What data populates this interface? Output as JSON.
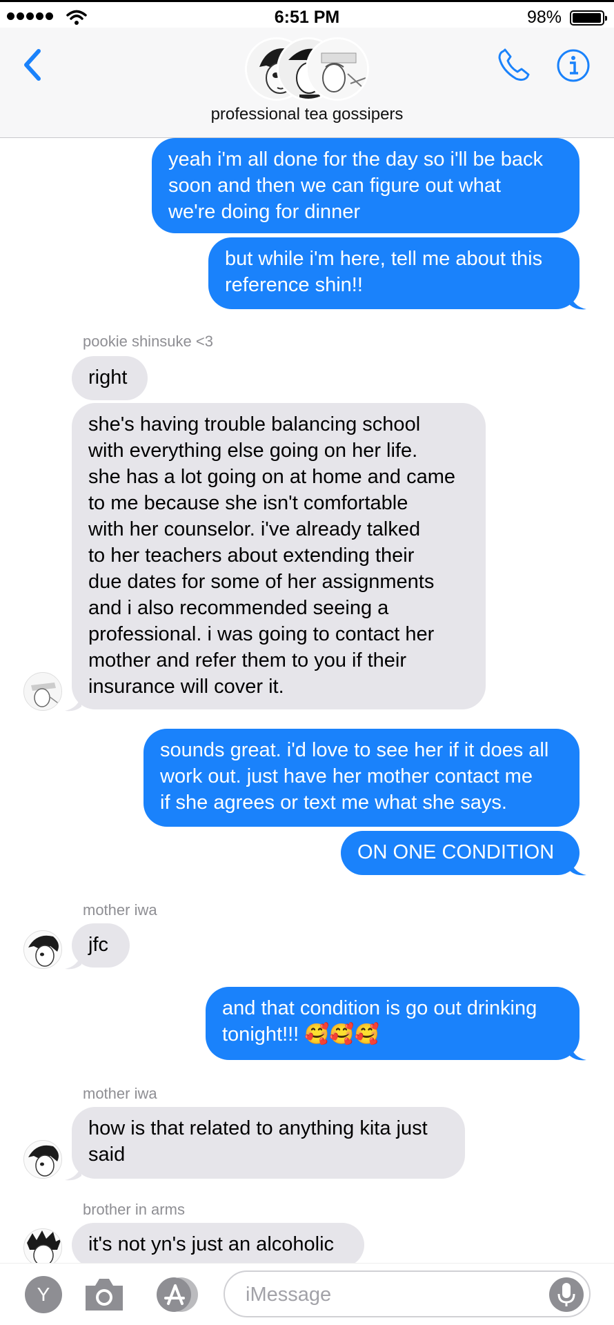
{
  "status_bar": {
    "time": "6:51 PM",
    "battery_percent": "98%",
    "icons": [
      "signal-dots-icon",
      "wifi-icon",
      "battery-icon"
    ]
  },
  "header": {
    "title": "professional tea gossipers",
    "icons": [
      "back-chevron-icon",
      "phone-icon",
      "info-icon"
    ],
    "accent_color": "#1a82fb"
  },
  "messages": [
    {
      "type": "sent",
      "text": "yeah i'm all done for the day so i'll be back\nsoon and then we can figure out what\nwe're doing for dinner"
    },
    {
      "type": "sent",
      "text": "but while i'm here, tell me about this\nreference shin!!"
    },
    {
      "type": "sender",
      "text": "pookie shinsuke <3"
    },
    {
      "type": "received",
      "text": "right"
    },
    {
      "type": "received",
      "text": "she's having trouble balancing school\nwith everything else going on her life.\nshe has a lot going on at home and came\nto me because she isn't comfortable\nwith her counselor. i've already talked\nto her teachers about extending their\ndue dates for some of her assignments\nand i also recommended seeing a\nprofessional. i was going to contact her\nmother and refer them to you if their\ninsurance will cover it."
    },
    {
      "type": "sent",
      "text": "sounds great. i'd love to see her if it does all\nwork out. just have her mother contact me\nif she agrees or text me what she says."
    },
    {
      "type": "sent",
      "text": "ON ONE CONDITION"
    },
    {
      "type": "sender",
      "text": "mother iwa"
    },
    {
      "type": "received",
      "text": "jfc"
    },
    {
      "type": "sent",
      "text": "and that condition is go out drinking\ntonight!!! 🥰🥰🥰"
    },
    {
      "type": "sender",
      "text": "mother iwa"
    },
    {
      "type": "received",
      "text": "how is that related to anything kita just\nsaid"
    },
    {
      "type": "sender",
      "text": "brother in arms"
    },
    {
      "type": "received",
      "text": "it's not yn's just an alcoholic"
    }
  ],
  "input_bar": {
    "placeholder": "iMessage",
    "app_label": "Y",
    "icons": [
      "camera-icon",
      "app-store-icon",
      "microphone-icon"
    ]
  },
  "colors": {
    "sent_bubble": "#1a82fb",
    "received_bubble": "#e6e5ea",
    "sender_name": "#8e8e93"
  }
}
